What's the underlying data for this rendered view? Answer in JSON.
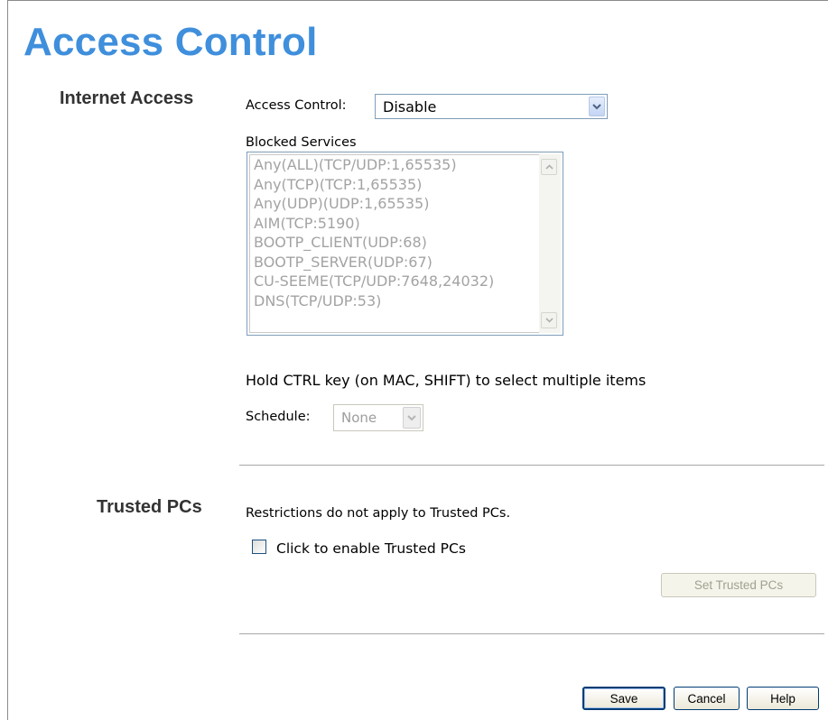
{
  "page_title": "Access Control",
  "internet_access": {
    "section_label": "Internet Access",
    "access_control_label": "Access Control:",
    "access_control_value": "Disable",
    "blocked_services_label": "Blocked Services",
    "blocked_services": [
      "Any(ALL)(TCP/UDP:1,65535)",
      "Any(TCP)(TCP:1,65535)",
      "Any(UDP)(UDP:1,65535)",
      "AIM(TCP:5190)",
      "BOOTP_CLIENT(UDP:68)",
      "BOOTP_SERVER(UDP:67)",
      "CU-SEEME(TCP/UDP:7648,24032)",
      "DNS(TCP/UDP:53)"
    ],
    "hint_text": "Hold CTRL key (on MAC, SHIFT) to select multiple items",
    "schedule_label": "Schedule:",
    "schedule_value": "None"
  },
  "trusted_pcs": {
    "section_label": "Trusted PCs",
    "description": "Restrictions do not apply to Trusted PCs.",
    "checkbox_label": "Click to enable Trusted PCs",
    "checkbox_checked": false,
    "set_button_label": "Set Trusted PCs"
  },
  "footer": {
    "save_label": "Save",
    "cancel_label": "Cancel",
    "help_label": "Help"
  },
  "colors": {
    "title": "#3f8fdc",
    "control_border": "#7f9db9",
    "disabled_text": "#a3a3a3"
  },
  "icons": {
    "dropdown": "chevron-down-icon",
    "scroll_up": "arrow-up-icon",
    "scroll_down": "arrow-down-icon"
  }
}
